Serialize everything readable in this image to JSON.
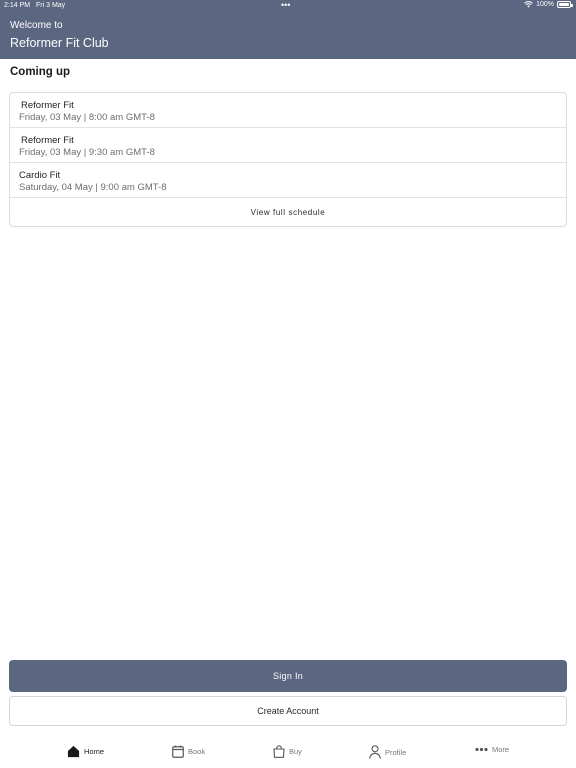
{
  "status_bar": {
    "time": "2:14 PM",
    "date": "Fri 3 May",
    "dots": "•••",
    "battery": "100%"
  },
  "header": {
    "welcome": "Welcome to",
    "club_name": "Reformer Fit Club"
  },
  "section": {
    "title": "Coming up"
  },
  "classes": [
    {
      "name": "Reformer Fit",
      "time": "Friday, 03 May | 8:00 am GMT-8"
    },
    {
      "name": "Reformer Fit",
      "time": "Friday, 03 May | 9:30 am GMT-8"
    },
    {
      "name": "Cardio Fit",
      "time": "Saturday, 04 May | 9:00 am GMT-8"
    }
  ],
  "view_schedule": "View full schedule",
  "buttons": {
    "sign_in": "Sign In",
    "create_account": "Create Account"
  },
  "tabs": [
    {
      "label": "Home",
      "icon": "home-icon",
      "active": true
    },
    {
      "label": "Book",
      "icon": "calendar-icon",
      "active": false
    },
    {
      "label": "Buy",
      "icon": "shopping-bag-icon",
      "active": false
    },
    {
      "label": "Profile",
      "icon": "person-icon",
      "active": false
    },
    {
      "label": "More",
      "icon": "more-dots-icon",
      "active": false
    }
  ],
  "colors": {
    "header": "#5b6680",
    "primary_button": "#5b6680"
  }
}
